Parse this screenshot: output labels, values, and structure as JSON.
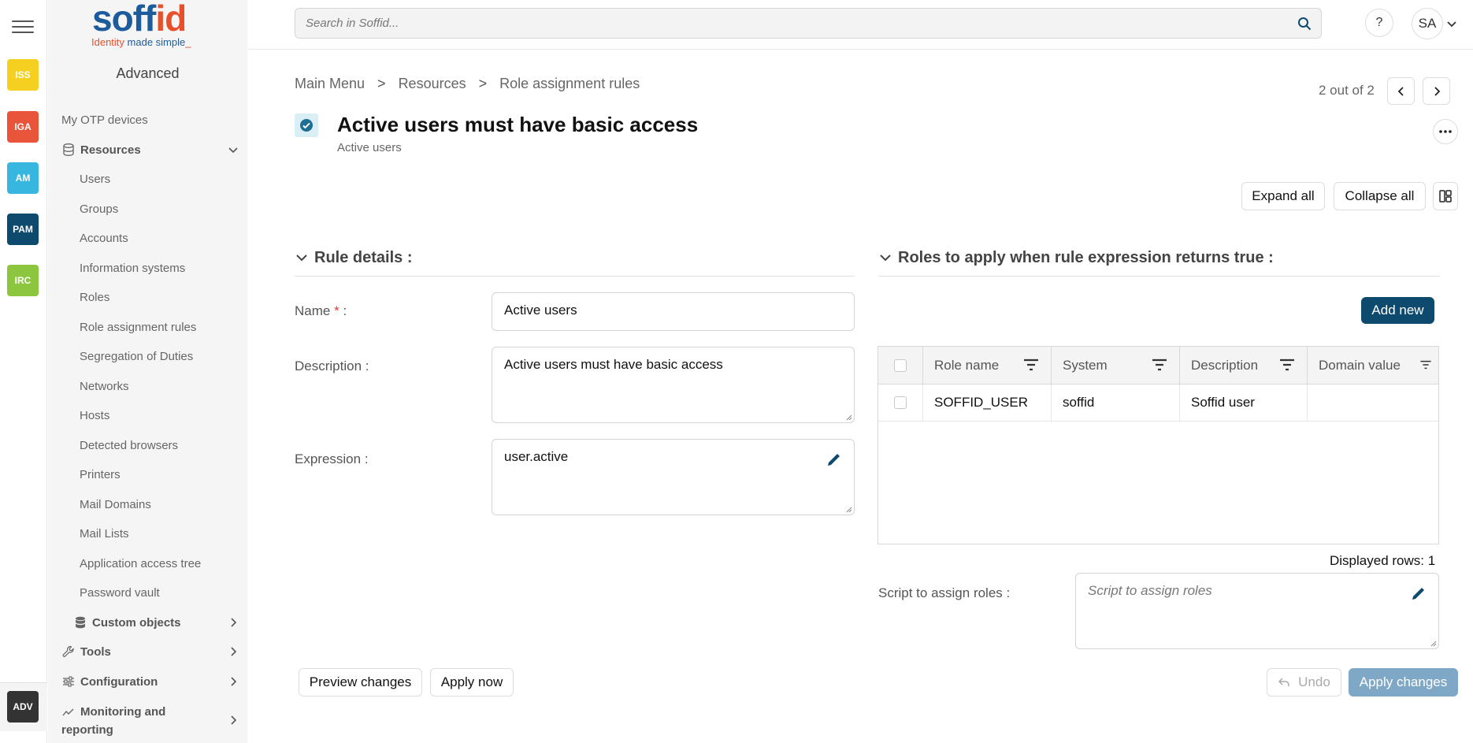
{
  "rail": {
    "chips": [
      {
        "label": "ISS",
        "color": "#f5d020"
      },
      {
        "label": "IGA",
        "color": "#e8553a"
      },
      {
        "label": "AM",
        "color": "#37b7e0"
      },
      {
        "label": "PAM",
        "color": "#0e4a6e"
      },
      {
        "label": "IRC",
        "color": "#8cc63f"
      }
    ],
    "active": "ADV"
  },
  "logo": {
    "word_a": "soff",
    "word_b": "id",
    "tag_a": "Identity ",
    "tag_b": "made simple",
    "tag_c": "_"
  },
  "sidenav": {
    "title": "Advanced",
    "otp": "My OTP devices",
    "resources_group": "Resources",
    "resources": [
      "Users",
      "Groups",
      "Accounts",
      "Information systems",
      "Roles",
      "Role assignment rules",
      "Segregation of Duties",
      "Networks",
      "Hosts",
      "Detected browsers",
      "Printers",
      "Mail Domains",
      "Mail Lists",
      "Application access tree",
      "Password vault"
    ],
    "custom_objects": "Custom objects",
    "tools": "Tools",
    "configuration": "Configuration",
    "monitoring": "Monitoring and reporting"
  },
  "header": {
    "search_placeholder": "Search in Soffid...",
    "help": "?",
    "avatar": "SA"
  },
  "breadcrumb": [
    "Main Menu",
    "Resources",
    "Role assignment rules"
  ],
  "breadcrumb_sep": ">",
  "pager": {
    "text": "2 out of 2"
  },
  "page": {
    "title": "Active users must have basic access",
    "subtitle": "Active users"
  },
  "toolbar": {
    "expand_all": "Expand all",
    "collapse_all": "Collapse all"
  },
  "rule_details": {
    "heading": "Rule details :",
    "name_label": "Name",
    "required_mark": "*",
    "name_suffix": " :",
    "name_value": "Active users",
    "description_label": "Description :",
    "description_value": "Active users must have basic access",
    "expression_label": "Expression :",
    "expression_value": "user.active"
  },
  "roles": {
    "heading": "Roles to apply when rule expression returns true :",
    "add_new": "Add new",
    "columns": [
      "Role name",
      "System",
      "Description",
      "Domain value"
    ],
    "rows": [
      {
        "role_name": "SOFFID_USER",
        "system": "soffid",
        "description": "Soffid user",
        "domain_value": ""
      }
    ],
    "displayed_rows": "Displayed rows: 1",
    "script_label": "Script to assign roles :",
    "script_placeholder": "Script to assign roles"
  },
  "footer": {
    "preview": "Preview changes",
    "apply_now": "Apply now",
    "undo": "Undo",
    "apply_changes": "Apply changes"
  }
}
